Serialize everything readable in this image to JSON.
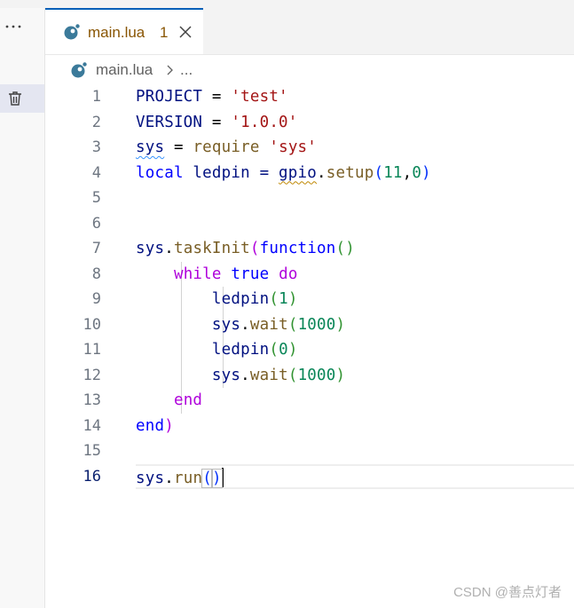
{
  "sidebar": {
    "more_icon": "ellipsis-icon",
    "trash_icon": "trash-icon"
  },
  "tab": {
    "title": "main.lua",
    "badge": "1",
    "icon": "lua-file-icon",
    "close_icon": "close-icon"
  },
  "breadcrumb": {
    "file": "main.lua",
    "more": "..."
  },
  "line_numbers": [
    "1",
    "2",
    "3",
    "4",
    "5",
    "6",
    "7",
    "8",
    "9",
    "10",
    "11",
    "12",
    "13",
    "14",
    "15",
    "16"
  ],
  "code": {
    "l1": {
      "a": "PROJECT",
      "b": " = ",
      "c": "'test'"
    },
    "l2": {
      "a": "VERSION",
      "b": " = ",
      "c": "'1.0.0'"
    },
    "l3": {
      "a": "sys",
      "b": " = ",
      "c": "require",
      "d": " ",
      "e": "'sys'"
    },
    "l4": {
      "a": "local",
      "b": " ledpin = ",
      "c": "gpio",
      "d": ".",
      "e": "setup",
      "f": "(",
      "g": "11",
      "h": ",",
      "i": "0",
      "j": ")"
    },
    "l7": {
      "a": "sys",
      "b": ".",
      "c": "taskInit",
      "d": "(",
      "e": "function",
      "f": "()"
    },
    "l8": {
      "a": "while",
      "b": " ",
      "c": "true",
      "d": " ",
      "e": "do"
    },
    "l9": {
      "a": "ledpin",
      "b": "(",
      "c": "1",
      "d": ")"
    },
    "l10": {
      "a": "sys",
      "b": ".",
      "c": "wait",
      "d": "(",
      "e": "1000",
      "f": ")"
    },
    "l11": {
      "a": "ledpin",
      "b": "(",
      "c": "0",
      "d": ")"
    },
    "l12": {
      "a": "sys",
      "b": ".",
      "c": "wait",
      "d": "(",
      "e": "1000",
      "f": ")"
    },
    "l13": {
      "a": "end"
    },
    "l14": {
      "a": "end",
      "b": ")"
    },
    "l16": {
      "a": "sys",
      "b": ".",
      "c": "run",
      "d": "(",
      "e": ")"
    }
  },
  "watermark": "CSDN @善点灯者",
  "colors": {
    "accent": "#005fb8",
    "tab_title": "#895503",
    "active_line_number": "#0b216f"
  }
}
